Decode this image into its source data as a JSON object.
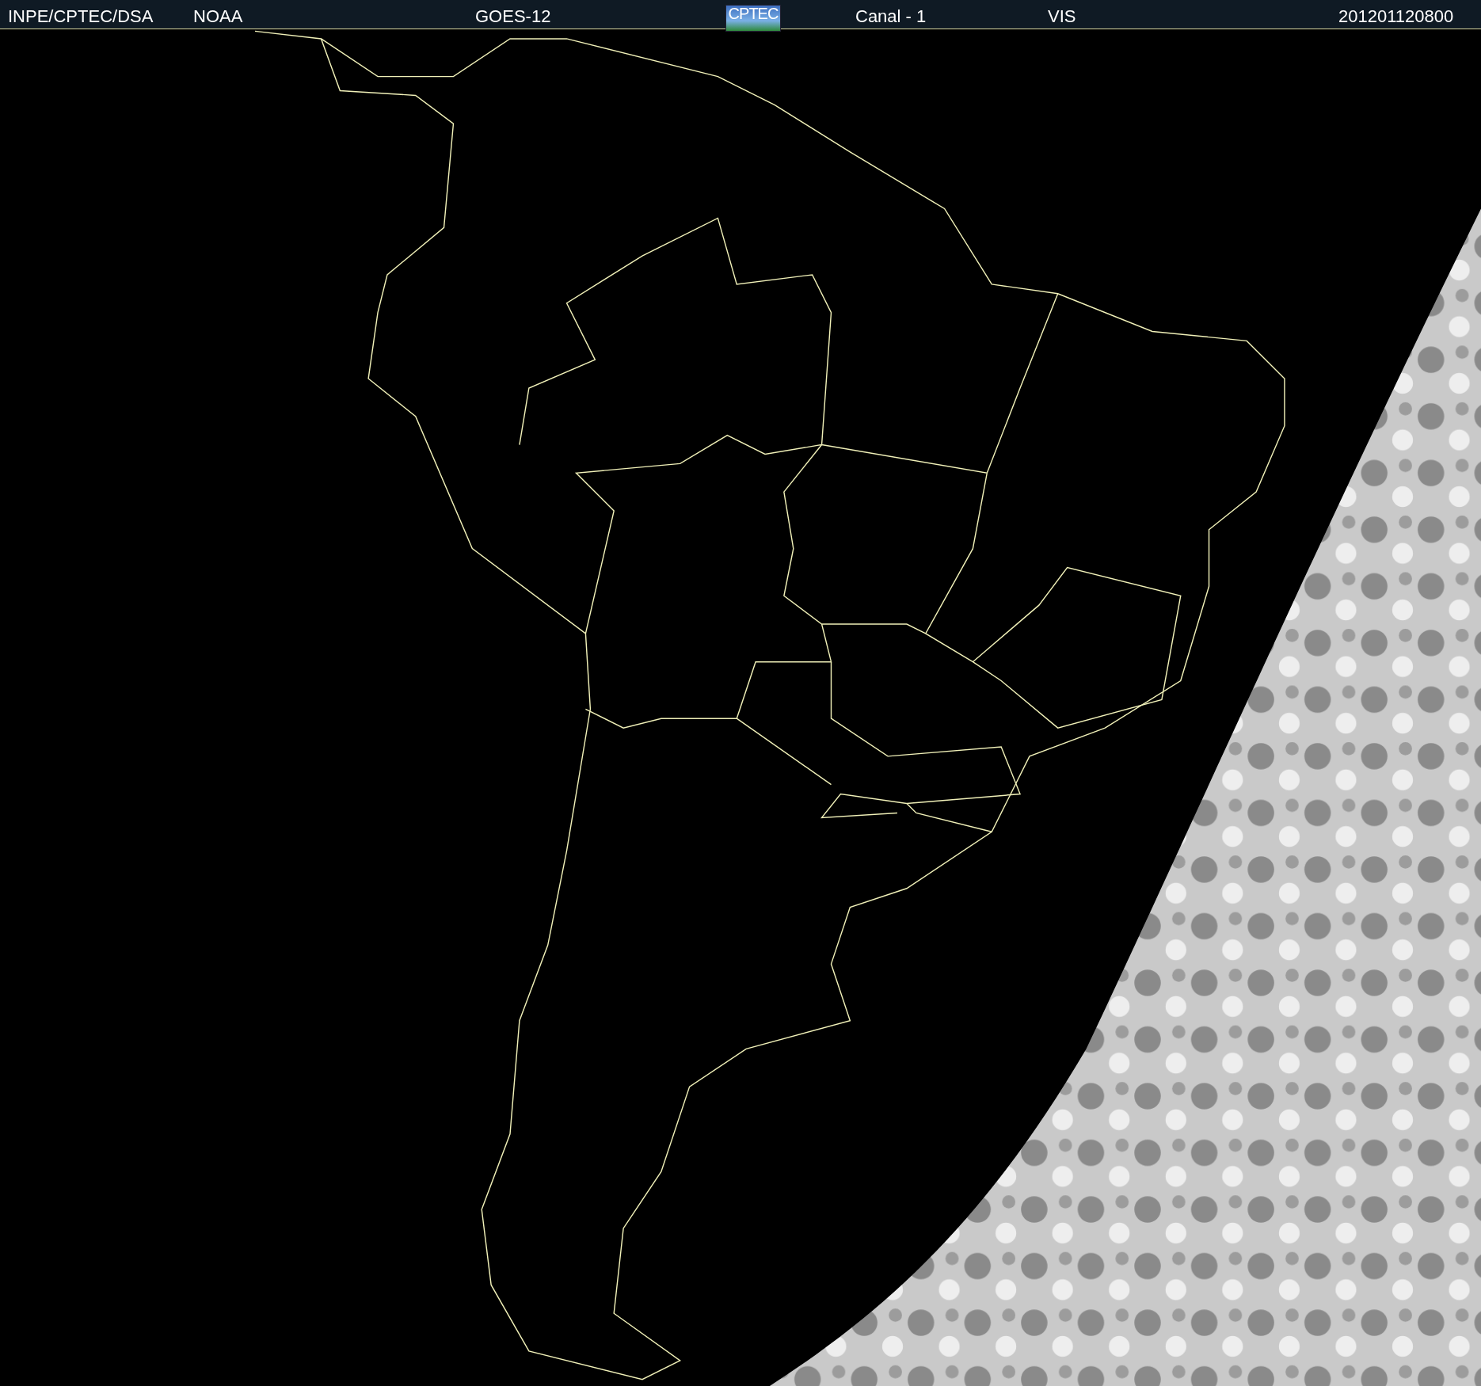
{
  "header": {
    "items": [
      {
        "kind": "text",
        "text": "INPE/CPTEC/DSA"
      },
      {
        "kind": "text",
        "text": "NOAA"
      },
      {
        "kind": "text",
        "text": "GOES-12"
      },
      {
        "kind": "logo",
        "text": "CPTEC"
      },
      {
        "kind": "text",
        "text": "Canal - 1"
      },
      {
        "kind": "text",
        "text": "VIS"
      },
      {
        "kind": "text",
        "text": "201201120800"
      }
    ]
  }
}
